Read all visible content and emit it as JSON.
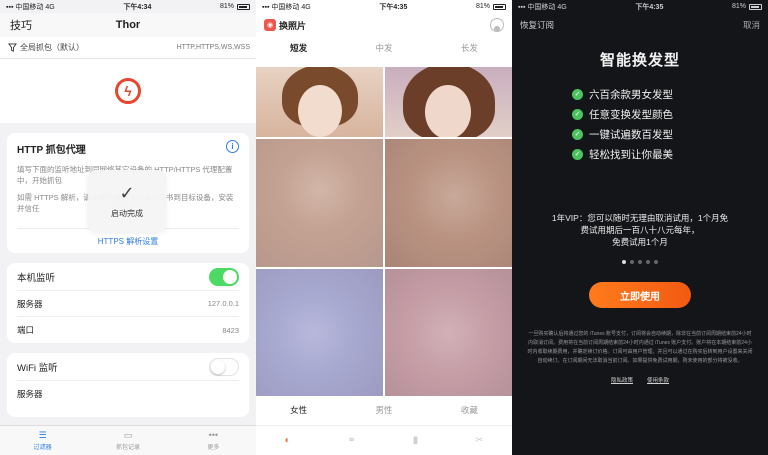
{
  "panel1": {
    "status": {
      "carrier": "中国移动",
      "network": "4G",
      "time": "下午4:34",
      "battery": "81%"
    },
    "nav": {
      "left": "技巧",
      "title": "Thor"
    },
    "filter": {
      "label": "全局抓包（默认）",
      "protocols": "HTTP,HTTPS,WS,WSS"
    },
    "proxy": {
      "title": "HTTP 抓包代理",
      "desc1": "填写下面的监听地址到同网络其它设备的 HTTP/HTTPS 代理配置中，开始抓包",
      "desc2": "如需 HTTPS 解析，请安装并信任 SSL CA 证书到目标设备，安装并信任",
      "link": "HTTPS 解析设置"
    },
    "toast": {
      "message": "启动完成"
    },
    "local": {
      "title": "本机监听",
      "server_label": "服务器",
      "server_value": "127.0.0.1",
      "port_label": "端口",
      "port_value": "8423"
    },
    "wifi": {
      "title": "WiFi 监听",
      "server_label": "服务器"
    },
    "tabbar": [
      {
        "label": "过滤器"
      },
      {
        "label": "抓包记录"
      },
      {
        "label": "更多"
      }
    ]
  },
  "panel2": {
    "status": {
      "carrier": "中国移动",
      "network": "4G",
      "time": "下午4:35",
      "battery": "81%"
    },
    "brand": "换照片",
    "tabs": [
      "短发",
      "中发",
      "长发"
    ],
    "gender_tabs": [
      "女性",
      "男性",
      "收藏"
    ]
  },
  "panel3": {
    "status": {
      "carrier": "中国移动",
      "network": "4G",
      "time": "下午4:35",
      "battery": "81%"
    },
    "nav": {
      "restore": "恢复订阅",
      "cancel": "取消"
    },
    "headline": "智能换发型",
    "features": [
      "六百余款男女发型",
      "任意变换发型颜色",
      "一键试遍数百发型",
      "轻松找到让你最美"
    ],
    "vip_line1": "1年VIP：您可以随时无理由取消试用，1个月免",
    "vip_line2": "费试用期后一百八十八元每年，",
    "vip_line3": "免费试用1个月",
    "cta": "立即使用",
    "legal": "一旦购买确认后将通过您的 iTunes 账号支付，订阅将会自动续期，除非在当前订阅周期结束前24小时内取消订阅。费用将在当前订阅周期结束前24小时内通过 iTunes 账户支付。账户将在本期结束前24小时内收取续期费用，并确定续订价格。订阅可由用户管理，并且可以通过在购买后转到用户设置来关闭自动续订。在订阅期间无法取消当前订阅。如果提供免费试用期，则未使用的部分将被没收。",
    "links": [
      "隐私政策",
      "使用条款"
    ]
  }
}
